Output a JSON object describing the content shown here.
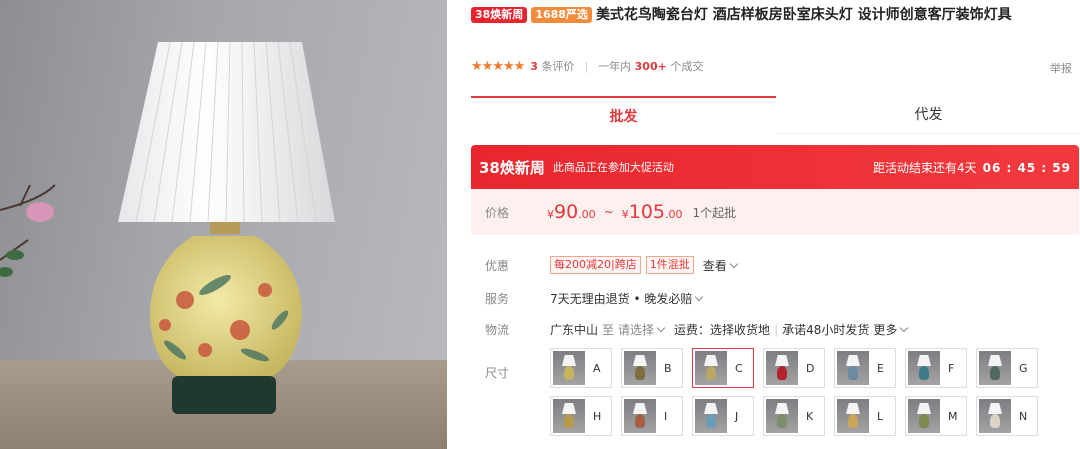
{
  "product": {
    "badge_festival": "38焕新周",
    "badge_1688": "1688严选",
    "title": "美式花鸟陶瓷台灯 酒店样板房卧室床头灯 设计师创意客厅装饰灯具",
    "stars": "★★★★★",
    "review_count": "3",
    "review_label": "条评价",
    "sales_prefix": "一年内",
    "sales_count": "300+",
    "sales_suffix": "个成交",
    "report": "举报"
  },
  "tabs": [
    {
      "label": "批发"
    },
    {
      "label": "代发"
    }
  ],
  "promo": {
    "title": "38焕新周",
    "subtitle": "此商品正在参加大促活动",
    "countdown_label": "距活动结束还有4天",
    "countdown_time": "06 : 45 : 59"
  },
  "price": {
    "label": "价格",
    "currency": "¥",
    "low_int": "90",
    "low_dec": ".00",
    "tilde": "~",
    "high_int": "105",
    "high_dec": ".00",
    "moq": "1个起批"
  },
  "offers": {
    "label": "优惠",
    "chips": [
      "每200减20|跨店",
      "1件混批"
    ],
    "view": "查看"
  },
  "service": {
    "label": "服务",
    "text": "7天无理由退货 • 晚发必赔"
  },
  "logistics": {
    "label": "物流",
    "origin": "广东中山",
    "to": "至",
    "choose": "请选择",
    "fee": "运费：选择收货地",
    "promise": "承诺48小时发货",
    "more": "更多"
  },
  "sizes": {
    "label": "尺寸",
    "selected": "C",
    "options": [
      "A",
      "B",
      "C",
      "D",
      "E",
      "F",
      "G",
      "H",
      "I",
      "J",
      "K",
      "L",
      "M",
      "N"
    ],
    "base_colors": [
      "#c7b35a",
      "#7c6e3e",
      "#b8a864",
      "#b2242c",
      "#6b8aa0",
      "#3d7b86",
      "#4f6a62",
      "#b59a4a",
      "#a55d43",
      "#6c9bb6",
      "#7c8e6a",
      "#cba65a",
      "#7d8a4e",
      "#d9d4c4"
    ]
  }
}
